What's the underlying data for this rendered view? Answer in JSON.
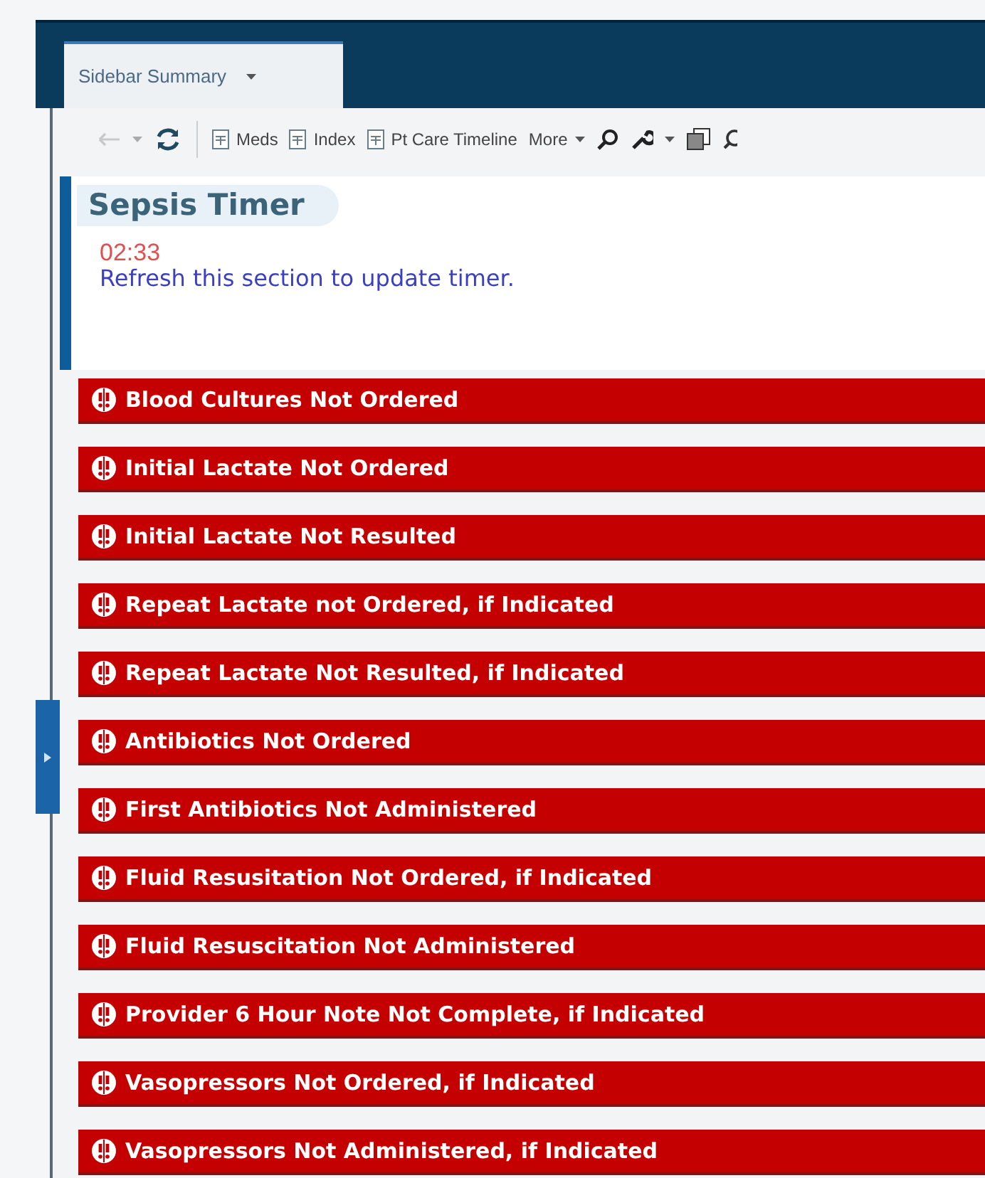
{
  "tabs": [
    {
      "label": "Sidebar Summary",
      "selected": true
    }
  ],
  "toolbar": {
    "back_disabled": true,
    "links": [
      {
        "label": "Meds"
      },
      {
        "label": "Index"
      },
      {
        "label": "Pt Care Timeline"
      }
    ],
    "more": "More"
  },
  "section": {
    "title": "Sepsis Timer",
    "timer": "02:33",
    "message": "Refresh this section to update timer."
  },
  "alerts": [
    {
      "text": "Blood Cultures Not Ordered"
    },
    {
      "text": "Initial Lactate Not Ordered"
    },
    {
      "text": "Initial Lactate Not Resulted"
    },
    {
      "text": "Repeat Lactate not Ordered, if Indicated"
    },
    {
      "text": "Repeat Lactate Not Resulted, if Indicated"
    },
    {
      "text": "Antibiotics Not Ordered"
    },
    {
      "text": "First Antibiotics Not Administered"
    },
    {
      "text": "Fluid Resusitation Not Ordered, if Indicated"
    },
    {
      "text": "Fluid Resuscitation Not Administered"
    },
    {
      "text": "Provider 6 Hour Note Not Complete, if Indicated"
    },
    {
      "text": "Vasopressors Not Ordered, if Indicated"
    },
    {
      "text": "Vasopressors Not Administered, if Indicated"
    }
  ]
}
